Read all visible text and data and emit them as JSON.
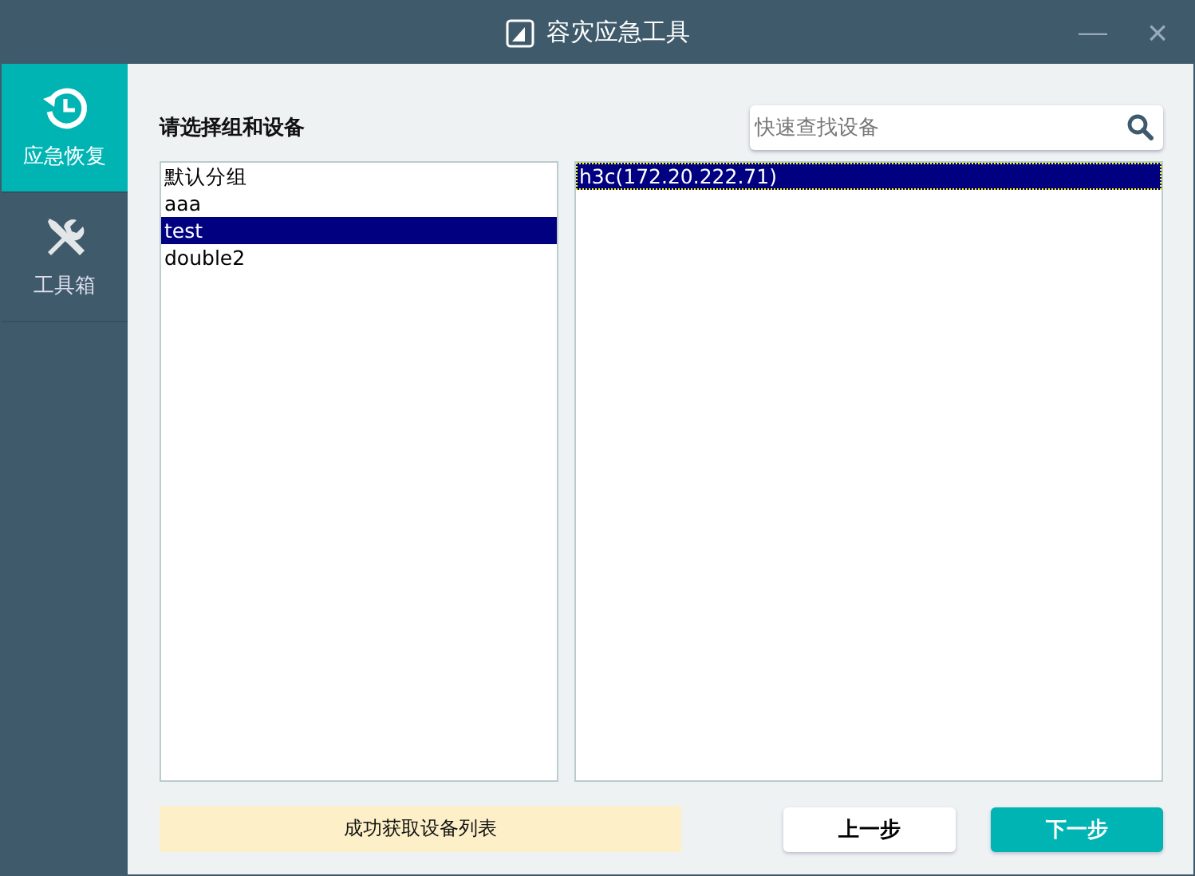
{
  "window": {
    "title": "容灾应急工具",
    "minimize": "—",
    "close": "×"
  },
  "sidebar": {
    "items": [
      {
        "label": "应急恢复",
        "kind": "restore",
        "selected": true
      },
      {
        "label": "工具箱",
        "kind": "tools",
        "selected": false
      }
    ]
  },
  "heading": "请选择组和设备",
  "search": {
    "placeholder": "快速查找设备"
  },
  "groups": [
    {
      "label": "默认分组",
      "selected": false
    },
    {
      "label": "aaa",
      "selected": false
    },
    {
      "label": "test",
      "selected": true
    },
    {
      "label": "double2",
      "selected": false
    }
  ],
  "devices": [
    {
      "label": "h3c(172.20.222.71)",
      "selected": true
    }
  ],
  "status": "成功获取设备列表",
  "buttons": [
    {
      "label": "上一步",
      "kind": "secondary"
    },
    {
      "label": "下一步",
      "kind": "primary"
    }
  ]
}
